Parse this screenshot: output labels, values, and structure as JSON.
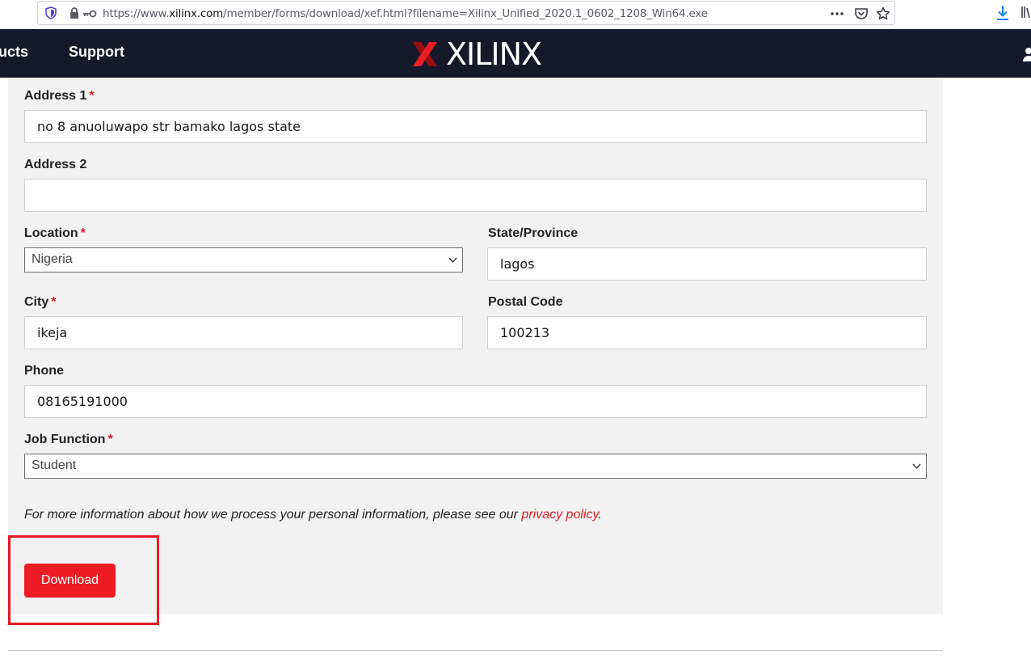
{
  "browser": {
    "url_prefix": "https://www.",
    "url_host": "xilinx.com",
    "url_path": "/member/forms/download/xef.html?filename=Xilinx_Unified_2020.1_0602_1208_Win64.exe"
  },
  "nav": {
    "item_products": "ucts",
    "item_support": "Support",
    "logo_text": "XILINX"
  },
  "form": {
    "address1": {
      "label": "Address 1",
      "required": "*",
      "value": "no 8 anuoluwapo str bamako lagos state"
    },
    "address2": {
      "label": "Address 2",
      "value": ""
    },
    "location": {
      "label": "Location",
      "required": "*",
      "selected": "Nigeria"
    },
    "state": {
      "label": "State/Province",
      "value": "lagos"
    },
    "city": {
      "label": "City",
      "required": "*",
      "value": "ikeja"
    },
    "postal": {
      "label": "Postal Code",
      "value": "100213"
    },
    "phone": {
      "label": "Phone",
      "value": "08165191000"
    },
    "job": {
      "label": "Job Function",
      "required": "*",
      "selected": "Student"
    },
    "note_text": "For more information about how we process your personal information, please see our ",
    "privacy_link": "privacy policy",
    "note_end": ".",
    "download_label": "Download"
  },
  "colors": {
    "brand_red": "#ed1c24",
    "nav_bg": "#15192a",
    "panel_bg": "#f2f2f2"
  }
}
